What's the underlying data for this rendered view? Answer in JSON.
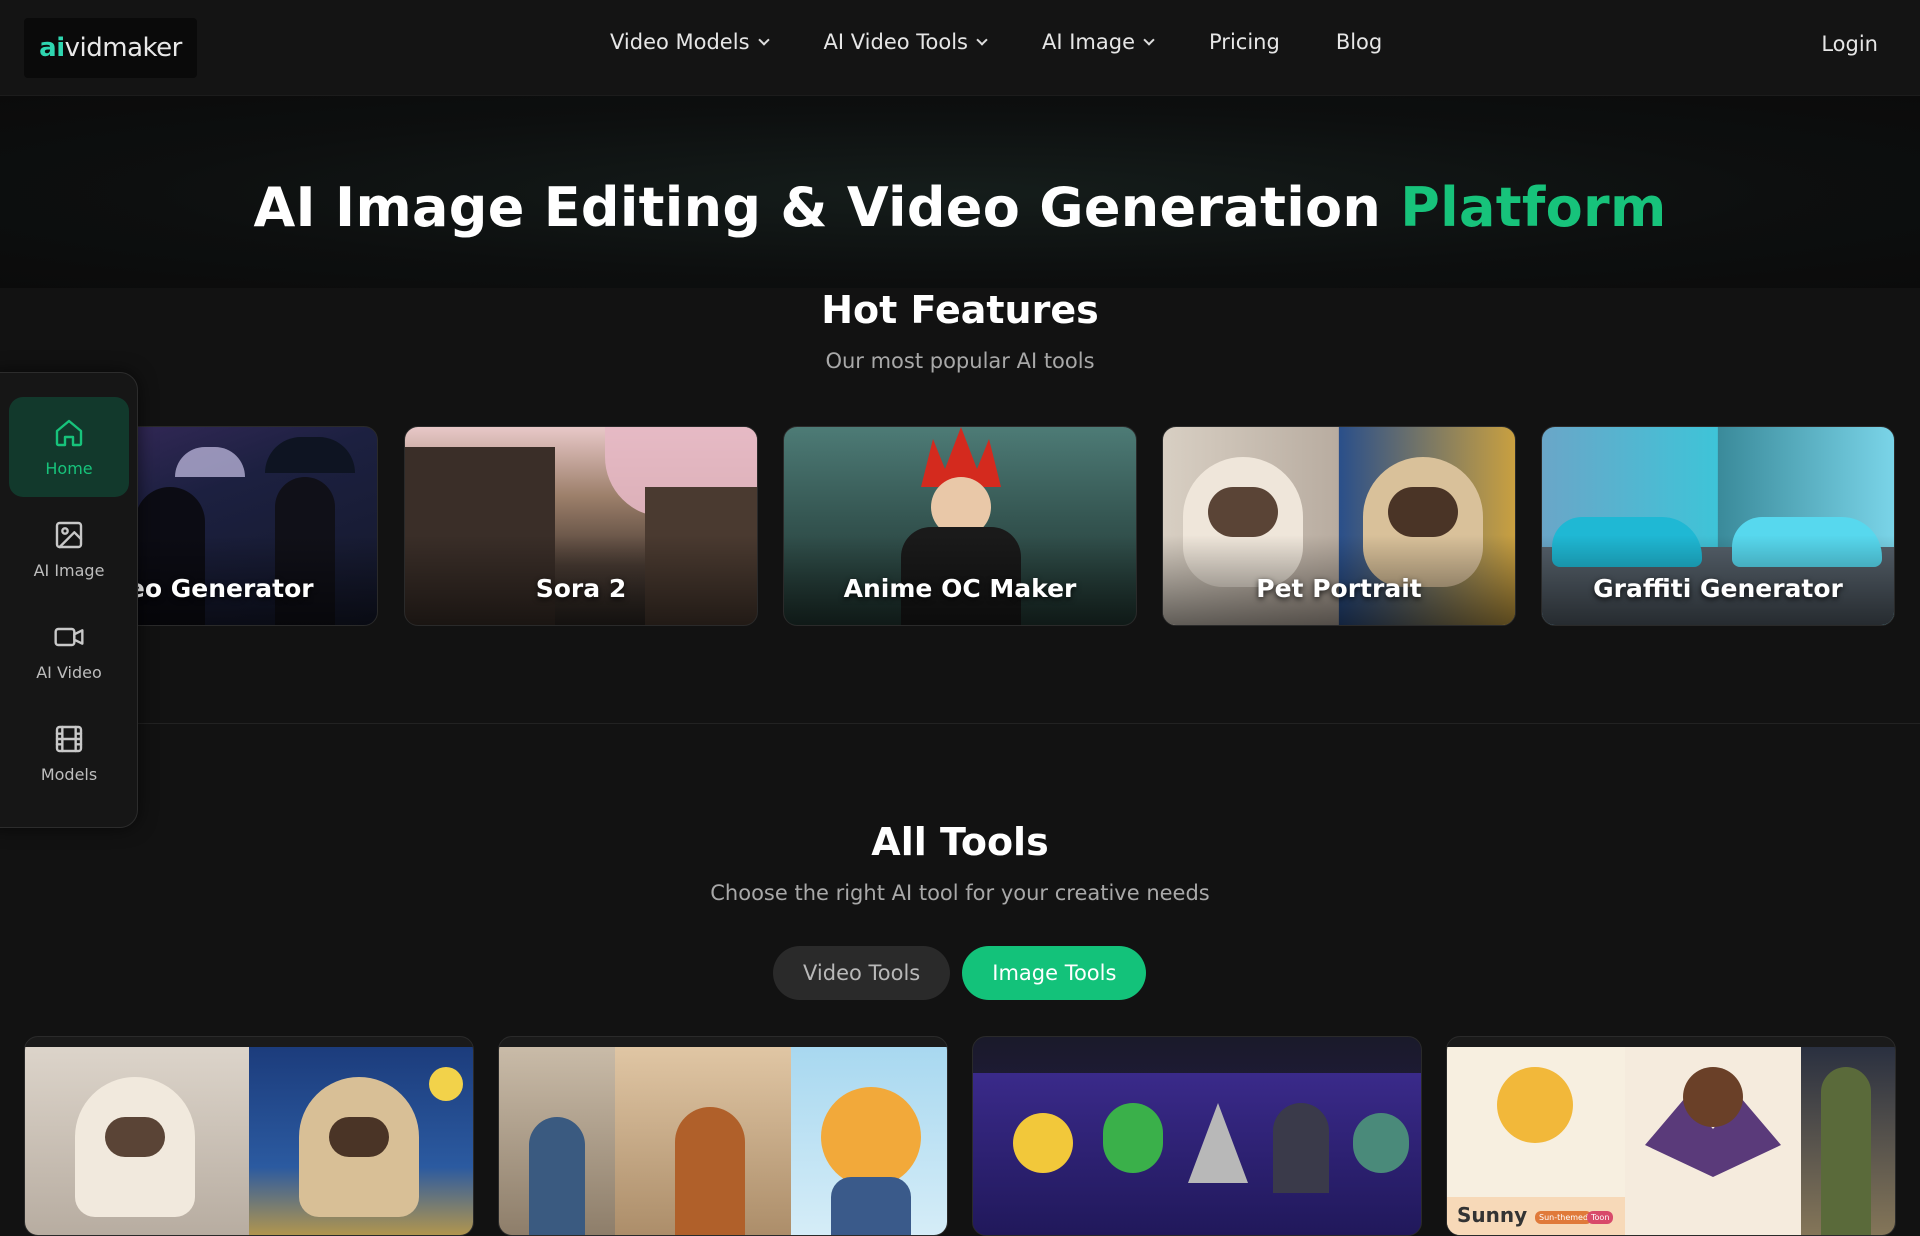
{
  "header": {
    "logo_ai": "ai",
    "logo_rest": "vidmaker",
    "nav": [
      {
        "label": "Video Models",
        "dropdown": true
      },
      {
        "label": "AI Video Tools",
        "dropdown": true
      },
      {
        "label": "AI Image",
        "dropdown": true
      },
      {
        "label": "Pricing",
        "dropdown": false
      },
      {
        "label": "Blog",
        "dropdown": false
      }
    ],
    "login_label": "Login"
  },
  "hero": {
    "title_main": "AI Image Editing & Video Generation ",
    "title_accent": "Platform",
    "accent_color": "#17c37b"
  },
  "hot_features": {
    "title": "Hot Features",
    "subtitle": "Our most popular AI tools",
    "cards": [
      {
        "label": "AI Video Generator",
        "visible_label": "deo Generator"
      },
      {
        "label": "Sora 2"
      },
      {
        "label": "Anime OC Maker"
      },
      {
        "label": "Pet Portrait"
      },
      {
        "label": "Graffiti Generator"
      }
    ]
  },
  "sidebar": {
    "items": [
      {
        "label": "Home",
        "icon": "home-icon",
        "active": true
      },
      {
        "label": "AI Image",
        "icon": "image-icon",
        "active": false
      },
      {
        "label": "AI Video",
        "icon": "video-icon",
        "active": false
      },
      {
        "label": "Models",
        "icon": "film-icon",
        "active": false
      }
    ]
  },
  "all_tools": {
    "title": "All Tools",
    "subtitle": "Choose the right AI tool for your creative needs",
    "tabs": [
      {
        "label": "Video Tools",
        "active": false
      },
      {
        "label": "Image Tools",
        "active": true
      }
    ],
    "card4_caption": "Sunny",
    "card4_badges": [
      "Sun-themed",
      "Toon"
    ]
  }
}
